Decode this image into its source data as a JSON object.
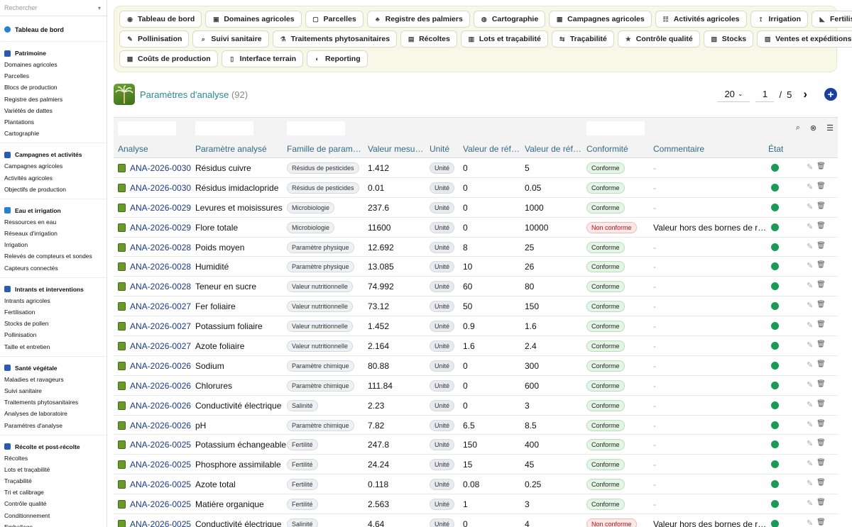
{
  "sidebar": {
    "search_placeholder": "Rechercher",
    "top_item": "Tableau de bord",
    "groups": [
      {
        "title": "Patrimoine",
        "color": "#2a5db0",
        "items": [
          "Domaines agricoles",
          "Parcelles",
          "Blocs de production",
          "Registre des palmiers",
          "Variétés de dattes",
          "Plantations",
          "Cartographie"
        ]
      },
      {
        "title": "Campagnes et activités",
        "color": "#2a5db0",
        "items": [
          "Campagnes agricoles",
          "Activités agricoles",
          "Objectifs de production"
        ]
      },
      {
        "title": "Eau et irrigation",
        "color": "#2a7fd0",
        "items": [
          "Ressources en eau",
          "Réseaux d'irrigation",
          "Irrigation",
          "Relevés de compteurs et sondes",
          "Capteurs connectés"
        ]
      },
      {
        "title": "Intrants et interventions",
        "color": "#2a5db0",
        "items": [
          "Intrants agricoles",
          "Fertilisation",
          "Stocks de pollen",
          "Pollinisation",
          "Taille et entretien"
        ]
      },
      {
        "title": "Santé végétale",
        "color": "#2a5db0",
        "items": [
          "Maladies et ravageurs",
          "Suivi sanitaire",
          "Traitements phytosanitaires",
          "Analyses de laboratoire",
          "Paramètres d'analyse"
        ]
      },
      {
        "title": "Récolte et post-récolte",
        "color": "#2a5db0",
        "items": [
          "Récoltes",
          "Lots et traçabilité",
          "Traçabilité",
          "Tri et calibrage",
          "Contrôle qualité",
          "Conditionnement",
          "Emballage"
        ]
      }
    ]
  },
  "modules": {
    "row1": [
      "Tableau de bord",
      "Domaines agricoles",
      "Parcelles",
      "Registre des palmiers",
      "Cartographie",
      "Campagnes agricoles",
      "Activités agricoles",
      "Irrigation",
      "Fertilisation"
    ],
    "row2": [
      "Pollinisation",
      "Suivi sanitaire",
      "Traitements phytosanitaires",
      "Récoltes",
      "Lots et traçabilité",
      "Traçabilité",
      "Contrôle qualité",
      "Stocks",
      "Ventes et expéditions"
    ],
    "row3": [
      "Coûts de production",
      "Interface terrain",
      "Reporting"
    ]
  },
  "page": {
    "title": "Paramètres d'analyse",
    "count": "(92)",
    "page_size": "20",
    "current_page": "1",
    "separator": "/",
    "total_pages": "5"
  },
  "table": {
    "headers": [
      "Analyse",
      "Paramètre analysé",
      "Famille de param…",
      "Valeur mesu…",
      "Unité",
      "Valeur de réf…",
      "Valeur de réf…",
      "Conformité",
      "Commentaire",
      "État"
    ],
    "rows": [
      {
        "analyse": "ANA-2026-0030",
        "param": "Résidus cuivre",
        "famille": "Résidus de pesticides",
        "valeur": "1.412",
        "unite": "Unité",
        "min": "0",
        "max": "5",
        "conf": "Conforme",
        "comment": "-"
      },
      {
        "analyse": "ANA-2026-0030",
        "param": "Résidus imidaclopride",
        "famille": "Résidus de pesticides",
        "valeur": "0.01",
        "unite": "Unité",
        "min": "0",
        "max": "0.05",
        "conf": "Conforme",
        "comment": "-"
      },
      {
        "analyse": "ANA-2026-0029",
        "param": "Levures et moisissures",
        "famille": "Microbiologie",
        "valeur": "237.6",
        "unite": "Unité",
        "min": "0",
        "max": "1000",
        "conf": "Conforme",
        "comment": "-"
      },
      {
        "analyse": "ANA-2026-0029",
        "param": "Flore totale",
        "famille": "Microbiologie",
        "valeur": "11600",
        "unite": "Unité",
        "min": "0",
        "max": "10000",
        "conf": "Non conforme",
        "comment": "Valeur hors des bornes de r…"
      },
      {
        "analyse": "ANA-2026-0028",
        "param": "Poids moyen",
        "famille": "Paramètre physique",
        "valeur": "12.692",
        "unite": "Unité",
        "min": "8",
        "max": "25",
        "conf": "Conforme",
        "comment": "-"
      },
      {
        "analyse": "ANA-2026-0028",
        "param": "Humidité",
        "famille": "Paramètre physique",
        "valeur": "13.085",
        "unite": "Unité",
        "min": "10",
        "max": "26",
        "conf": "Conforme",
        "comment": "-"
      },
      {
        "analyse": "ANA-2026-0028",
        "param": "Teneur en sucre",
        "famille": "Valeur nutritionnelle",
        "valeur": "74.992",
        "unite": "Unité",
        "min": "60",
        "max": "80",
        "conf": "Conforme",
        "comment": "-"
      },
      {
        "analyse": "ANA-2026-0027",
        "param": "Fer foliaire",
        "famille": "Valeur nutritionnelle",
        "valeur": "73.12",
        "unite": "Unité",
        "min": "50",
        "max": "150",
        "conf": "Conforme",
        "comment": "-"
      },
      {
        "analyse": "ANA-2026-0027",
        "param": "Potassium foliaire",
        "famille": "Valeur nutritionnelle",
        "valeur": "1.452",
        "unite": "Unité",
        "min": "0.9",
        "max": "1.6",
        "conf": "Conforme",
        "comment": "-"
      },
      {
        "analyse": "ANA-2026-0027",
        "param": "Azote foliaire",
        "famille": "Valeur nutritionnelle",
        "valeur": "2.164",
        "unite": "Unité",
        "min": "1.6",
        "max": "2.4",
        "conf": "Conforme",
        "comment": "-"
      },
      {
        "analyse": "ANA-2026-0026",
        "param": "Sodium",
        "famille": "Paramètre chimique",
        "valeur": "80.88",
        "unite": "Unité",
        "min": "0",
        "max": "300",
        "conf": "Conforme",
        "comment": "-"
      },
      {
        "analyse": "ANA-2026-0026",
        "param": "Chlorures",
        "famille": "Paramètre chimique",
        "valeur": "111.84",
        "unite": "Unité",
        "min": "0",
        "max": "600",
        "conf": "Conforme",
        "comment": "-"
      },
      {
        "analyse": "ANA-2026-0026",
        "param": "Conductivité électrique",
        "famille": "Salinité",
        "valeur": "2.23",
        "unite": "Unité",
        "min": "0",
        "max": "3",
        "conf": "Conforme",
        "comment": "-"
      },
      {
        "analyse": "ANA-2026-0026",
        "param": "pH",
        "famille": "Paramètre chimique",
        "valeur": "7.82",
        "unite": "Unité",
        "min": "6.5",
        "max": "8.5",
        "conf": "Conforme",
        "comment": "-"
      },
      {
        "analyse": "ANA-2026-0025",
        "param": "Potassium échangeable",
        "famille": "Fertilité",
        "valeur": "247.8",
        "unite": "Unité",
        "min": "150",
        "max": "400",
        "conf": "Conforme",
        "comment": "-"
      },
      {
        "analyse": "ANA-2026-0025",
        "param": "Phosphore assimilable",
        "famille": "Fertilité",
        "valeur": "24.24",
        "unite": "Unité",
        "min": "15",
        "max": "45",
        "conf": "Conforme",
        "comment": "-"
      },
      {
        "analyse": "ANA-2026-0025",
        "param": "Azote total",
        "famille": "Fertilité",
        "valeur": "0.118",
        "unite": "Unité",
        "min": "0.08",
        "max": "0.25",
        "conf": "Conforme",
        "comment": "-"
      },
      {
        "analyse": "ANA-2026-0025",
        "param": "Matière organique",
        "famille": "Fertilité",
        "valeur": "2.563",
        "unite": "Unité",
        "min": "1",
        "max": "3",
        "conf": "Conforme",
        "comment": "-"
      },
      {
        "analyse": "ANA-2026-0025",
        "param": "Conductivité électrique",
        "famille": "Salinité",
        "valeur": "4.64",
        "unite": "Unité",
        "min": "0",
        "max": "4",
        "conf": "Non conforme",
        "comment": "Valeur hors des bornes de r…"
      }
    ]
  },
  "colors": {
    "accent": "#2a8a8a",
    "status_ok": "#1a9a55",
    "add": "#1a3f9c"
  }
}
